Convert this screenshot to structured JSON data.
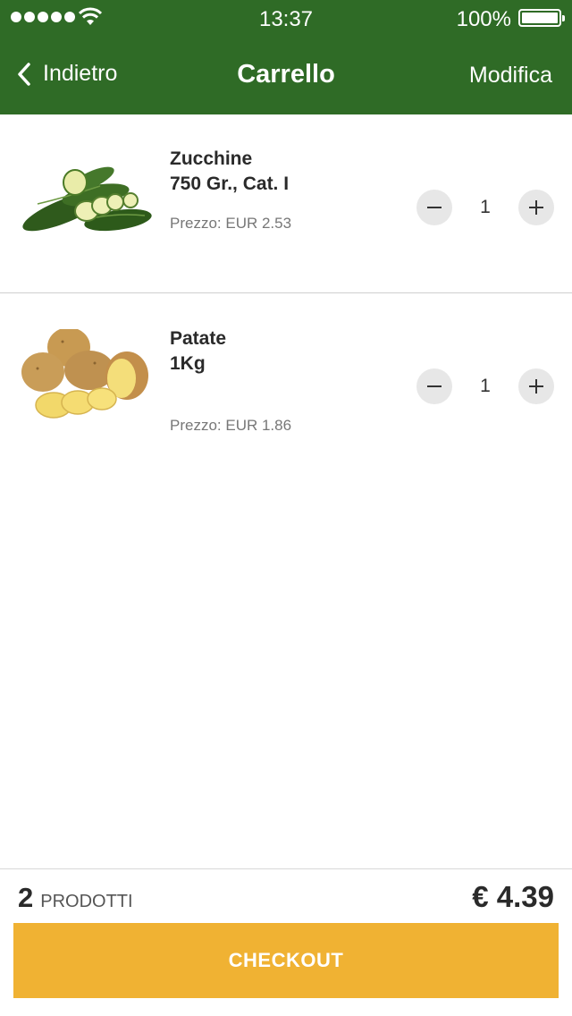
{
  "status_bar": {
    "time": "13:37",
    "battery": "100%"
  },
  "nav": {
    "back_label": "Indietro",
    "title": "Carrello",
    "edit_label": "Modifica"
  },
  "items": [
    {
      "name_line1": "Zucchine",
      "name_line2": "750 Gr., Cat. I",
      "price": "Prezzo: EUR 2.53",
      "quantity": "1",
      "image": "zucchini-image"
    },
    {
      "name_line1": "Patate",
      "name_line2": "1Kg",
      "price": "Prezzo:  EUR 1.86",
      "quantity": "1",
      "image": "potatoes-image"
    }
  ],
  "footer": {
    "count": "2",
    "count_label": "PRODOTTI",
    "total": "€ 4.39",
    "checkout_label": "CHECKOUT"
  },
  "colors": {
    "header": "#2f6b26",
    "checkout": "#f0b233",
    "stepper_bg": "#e7e7e7"
  }
}
